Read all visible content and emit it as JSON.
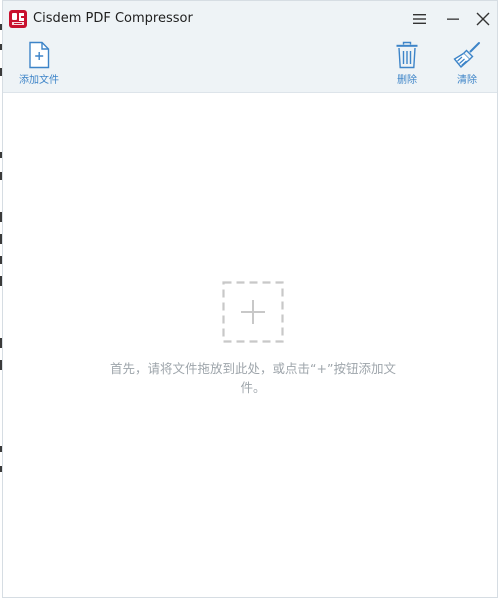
{
  "window": {
    "title": "Cisdem PDF Compressor"
  },
  "toolbar": {
    "add_label": "添加文件",
    "delete_label": "删除",
    "clear_label": "清除"
  },
  "main": {
    "hint": "首先，请将文件拖放到此处，或点击“+”按钮添加文件。"
  },
  "colors": {
    "accent": "#3d84c8",
    "title_bg": "#eef3f6",
    "hint_text": "#9ea5ab",
    "dashed_border": "#c8c8c8",
    "logo_red": "#c8102e"
  },
  "icons": {
    "logo": "app-logo-icon",
    "menu": "hamburger-menu-icon",
    "minimize": "minimize-icon",
    "close": "close-icon",
    "add": "add-file-icon",
    "delete": "trash-icon",
    "clear": "broom-icon",
    "drop": "plus-icon"
  }
}
